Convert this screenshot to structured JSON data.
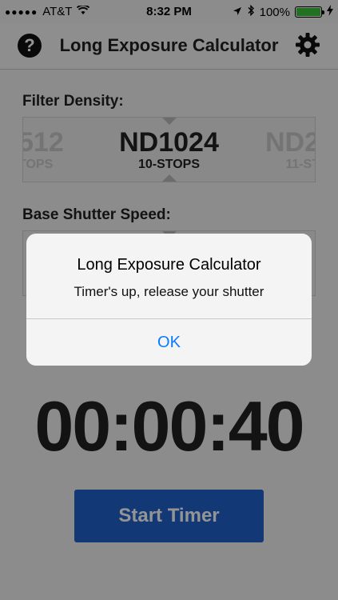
{
  "status_bar": {
    "carrier": "AT&T",
    "time": "8:32 PM",
    "battery": "100%"
  },
  "navbar": {
    "title": "Long Exposure Calculator"
  },
  "filter_density": {
    "label": "Filter Density:",
    "items": [
      {
        "main": "512",
        "sub": "TOPS"
      },
      {
        "main": "ND1024",
        "sub": "10-STOPS"
      },
      {
        "main": "ND2",
        "sub": "11-ST"
      }
    ]
  },
  "base_shutter": {
    "label": "Base Shutter Speed:"
  },
  "timer": {
    "display": "00:00:40",
    "button_label": "Start Timer"
  },
  "alert": {
    "title": "Long Exposure Calculator",
    "message": "Timer's up, release your shutter",
    "ok_label": "OK"
  },
  "colors": {
    "button": "#1f62cc",
    "battery": "#3cc13c",
    "alert_action": "#0a7aff"
  }
}
